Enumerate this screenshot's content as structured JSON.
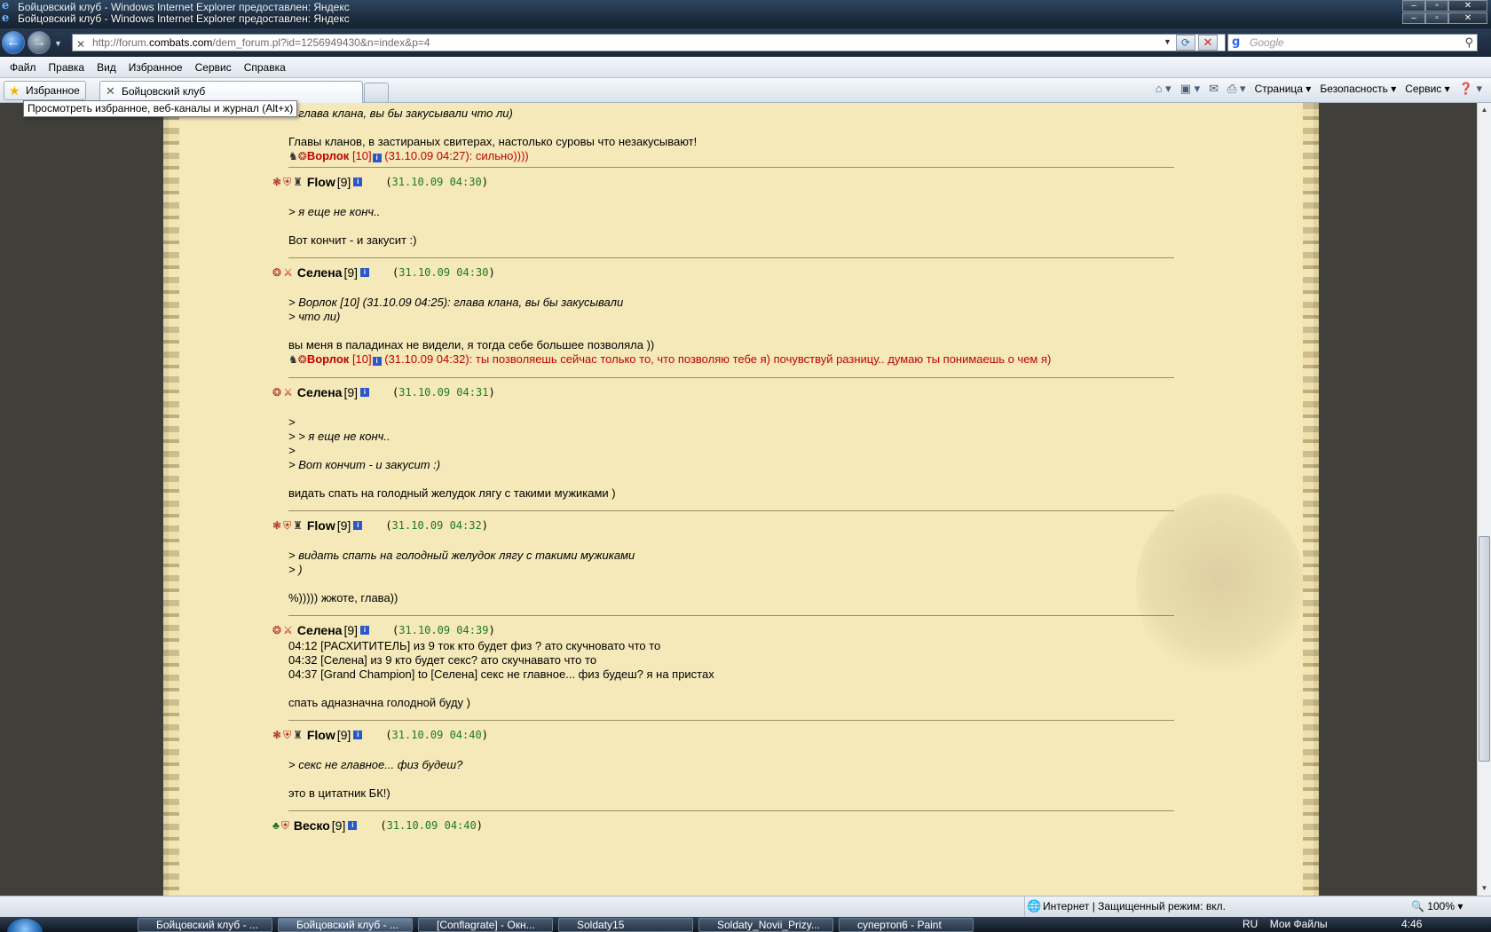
{
  "window": {
    "title_back": "Бойцовский клуб - Windows Internet Explorer предоставлен: Яндекс",
    "title_front": "Бойцовский клуб - Windows Internet Explorer предоставлен: Яндекс"
  },
  "address": {
    "url_prefix": "http://forum.",
    "url_domain": "combats.com",
    "url_path": "/dem_forum.pl?id=1256949430&n=index&p=4",
    "search_placeholder": "Google"
  },
  "menu": [
    "Файл",
    "Правка",
    "Вид",
    "Избранное",
    "Сервис",
    "Справка"
  ],
  "favbar": {
    "favorites_label": "Избранное",
    "tab_title": "Бойцовский клуб",
    "tooltip": "Просмотреть избранное, веб-каналы и журнал (Alt+x)",
    "cmd_page": "Страница",
    "cmd_safety": "Безопасность",
    "cmd_tools": "Сервис"
  },
  "top_fragment": {
    "quote": "> глава клана, вы бы закусывали что ли)",
    "text": "Главы кланов, в застираных свитерах, настолько суровы что незакусывают!",
    "reply_name": "Ворлок",
    "reply_level": "[10]",
    "reply_text": "(31.10.09 04:27): сильно))))"
  },
  "posts": [
    {
      "name": "Flow",
      "level": "[9]",
      "date": "31.10.09 04:30",
      "quotes": [
        "> я еще не конч.."
      ],
      "lines": [
        "Вот кончит - и закусит :)"
      ]
    },
    {
      "name": "Селена",
      "level": "[9]",
      "date": "31.10.09 04:30",
      "quotes": [
        ">  Ворлок [10] (31.10.09 04:25): глава клана, вы бы закусывали",
        "> что ли)"
      ],
      "lines": [
        "вы меня в паладинах не видели, я тогда себе большее позволяла ))"
      ],
      "reply": {
        "name": "Ворлок",
        "level": "[10]",
        "text": "(31.10.09 04:32): ты позволяешь сейчас только то, что позволяю тебе я) почувствуй разницу.. думаю ты понимаешь о чем я)"
      }
    },
    {
      "name": "Селена",
      "level": "[9]",
      "date": "31.10.09 04:31",
      "quotes": [
        ">",
        "> > я еще не конч..",
        ">",
        "> Вот кончит - и закусит :)"
      ],
      "lines": [
        "видать спать на голодный желудок лягу с такими мужиками )"
      ]
    },
    {
      "name": "Flow",
      "level": "[9]",
      "date": "31.10.09 04:32",
      "quotes": [
        "> видать спать на голодный желудок лягу с такими мужиками",
        "> )"
      ],
      "lines": [
        "%))))) жжоте, глава))"
      ]
    },
    {
      "name": "Селена",
      "level": "[9]",
      "date": "31.10.09 04:39",
      "pre": [
        "04:12 [РАСХИТИТЕЛЬ] из 9 ток кто будет физ ? ато скучновато что то",
        "04:32 [Селена] из 9 кто будет секс? ато скучнавато что то",
        "04:37 [Grand Champion] to [Селена] секс не главное... физ будеш? я на пристах"
      ],
      "lines": [
        "спать адназначна голодной буду )"
      ]
    },
    {
      "name": "Flow",
      "level": "[9]",
      "date": "31.10.09 04:40",
      "quotes": [
        "> секс не главное... физ будеш?"
      ],
      "lines": [
        "это в цитатник БК!)"
      ]
    },
    {
      "name": "Веско",
      "level": "[9]",
      "date": "31.10.09 04:40",
      "quotes": [],
      "lines": []
    }
  ],
  "status": {
    "zone": "Интернет | Защищенный режим: вкл.",
    "zoom": "100%"
  },
  "taskbar": {
    "items": [
      "Бойцовский клуб - ...",
      "Бойцовский клуб - ...",
      "[Conflagrate] - Окн...",
      "Soldaty15",
      "Soldaty_Novii_Prizy...",
      "супертоп6 - Paint"
    ],
    "lang": "RU",
    "files": "Мои Файлы",
    "time": "4:46"
  }
}
